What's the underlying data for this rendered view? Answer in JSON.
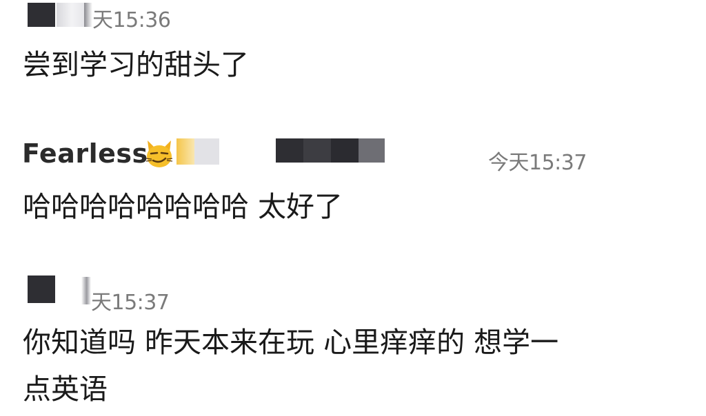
{
  "messages": [
    {
      "time": "天15:36",
      "text_lines": [
        "尝到学习的甜头了"
      ]
    },
    {
      "sender": "Fearless",
      "sender_emoji": "smirking-cat-emoji",
      "time": "今天15:37",
      "text_lines": [
        "哈哈哈哈哈哈哈哈 太好了"
      ]
    },
    {
      "time": "天15:37",
      "text_lines": [
        "你知道吗 昨天本来在玩 心里痒痒的 想学一",
        "点英语"
      ]
    }
  ],
  "colors": {
    "background": "#ffffff",
    "text": "#1a1a1a",
    "timestamp": "#7a7a7a",
    "sender": "#2b2b2b",
    "redaction_dark": "#2e2e33"
  }
}
